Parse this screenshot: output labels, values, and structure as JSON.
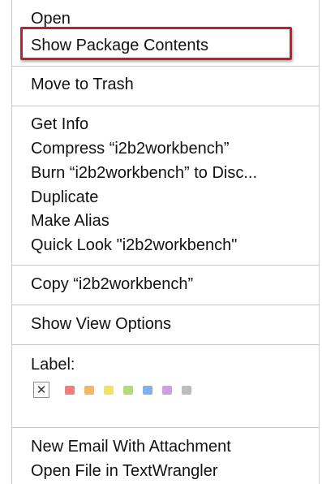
{
  "menu": {
    "items": {
      "open": "Open",
      "show_package_contents": "Show Package Contents",
      "move_to_trash": "Move to Trash",
      "get_info": "Get Info",
      "compress": "Compress “i2b2workbench”",
      "burn": "Burn “i2b2workbench” to Disc...",
      "duplicate": "Duplicate",
      "make_alias": "Make Alias",
      "quick_look": "Quick Look \"i2b2workbench\"",
      "copy": "Copy “i2b2workbench”",
      "show_view_options": "Show View Options",
      "new_email": "New Email With Attachment",
      "open_in_textwrangler": "Open File in TextWrangler"
    },
    "label": {
      "title": "Label:",
      "none_glyph": "✕",
      "colors": {
        "red": "#f27d7d",
        "orange": "#f5b665",
        "yellow": "#efe36a",
        "green": "#b3dc76",
        "blue": "#7fb1ee",
        "purple": "#d19ee3",
        "gray": "#bdbdbd"
      }
    },
    "highlight_color": "#c0202e"
  }
}
